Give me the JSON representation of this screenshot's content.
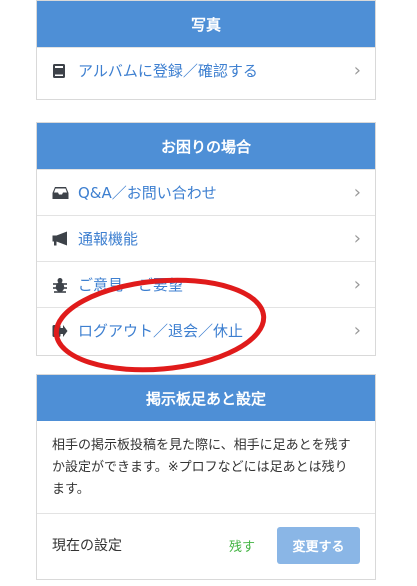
{
  "photo": {
    "title": "写真",
    "items": [
      {
        "label": "アルバムに登録／確認する",
        "icon": "book-icon"
      }
    ]
  },
  "help": {
    "title": "お困りの場合",
    "items": [
      {
        "label": "Q&A／お問い合わせ",
        "icon": "inbox-icon"
      },
      {
        "label": "通報機能",
        "icon": "megaphone-icon"
      },
      {
        "label": "ご意見・ご要望",
        "icon": "bug-icon"
      },
      {
        "label": "ログアウト／退会／休止",
        "icon": "logout-icon"
      }
    ]
  },
  "footprint": {
    "title": "掲示板足あと設定",
    "description": "相手の掲示板投稿を見た際に、相手に足あとを残すか設定ができます。※プロフなどには足あとは残ります。",
    "current_label": "現在の設定",
    "current_value": "残す",
    "change_label": "変更する"
  },
  "annotation": {
    "color": "#e01b1b"
  },
  "colors": {
    "header": "#4e8fd6",
    "link": "#3d7fd0",
    "button": "#8ab6e6",
    "value": "#43b443"
  }
}
